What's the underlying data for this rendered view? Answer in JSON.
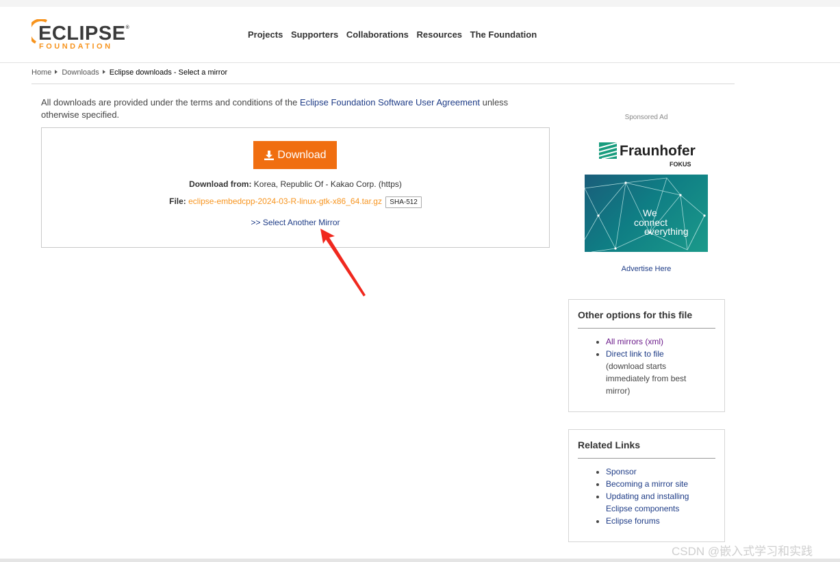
{
  "logo": {
    "name": "ECLIPSE",
    "registered": "®",
    "subtitle": "FOUNDATION"
  },
  "nav": [
    "Projects",
    "Supporters",
    "Collaborations",
    "Resources",
    "The Foundation"
  ],
  "breadcrumb": {
    "home": "Home",
    "downloads": "Downloads",
    "current": "Eclipse downloads - Select a mirror"
  },
  "terms": {
    "prefix": "All downloads are provided under the terms and conditions of the ",
    "link": "Eclipse Foundation Software User Agreement",
    "suffix": " unless otherwise specified."
  },
  "download": {
    "button_label": "Download",
    "from_label": "Download from:",
    "from_value": " Korea, Republic Of - Kakao Corp. (https)",
    "file_label": "File:",
    "file_name": "eclipse-embedcpp-2024-03-R-linux-gtk-x86_64.tar.gz",
    "checksum": "SHA-512",
    "mirror_link": ">> Select Another Mirror"
  },
  "ad": {
    "label": "Sponsored Ad",
    "brand": "Fraunhofer",
    "brand_sub": "FOKUS",
    "line1": "We",
    "line2": "connect",
    "line3": "everything",
    "advertise": "Advertise Here"
  },
  "other_options": {
    "title": "Other options for this file",
    "all_mirrors": "All mirrors",
    "xml": "xml",
    "direct_link": "Direct link to file",
    "direct_note": "(download starts immediately from best mirror)"
  },
  "related": {
    "title": "Related Links",
    "items": [
      "Sponsor",
      "Becoming a mirror site",
      "Updating and installing Eclipse components",
      "Eclipse forums"
    ]
  },
  "watermark": "CSDN @嵌入式学习和实践",
  "colors": {
    "accent": "#f06e10",
    "link": "#1d3b86",
    "file_link": "#f7941e",
    "visited": "#6b1a8a",
    "annotation_arrow": "#f0281e"
  }
}
